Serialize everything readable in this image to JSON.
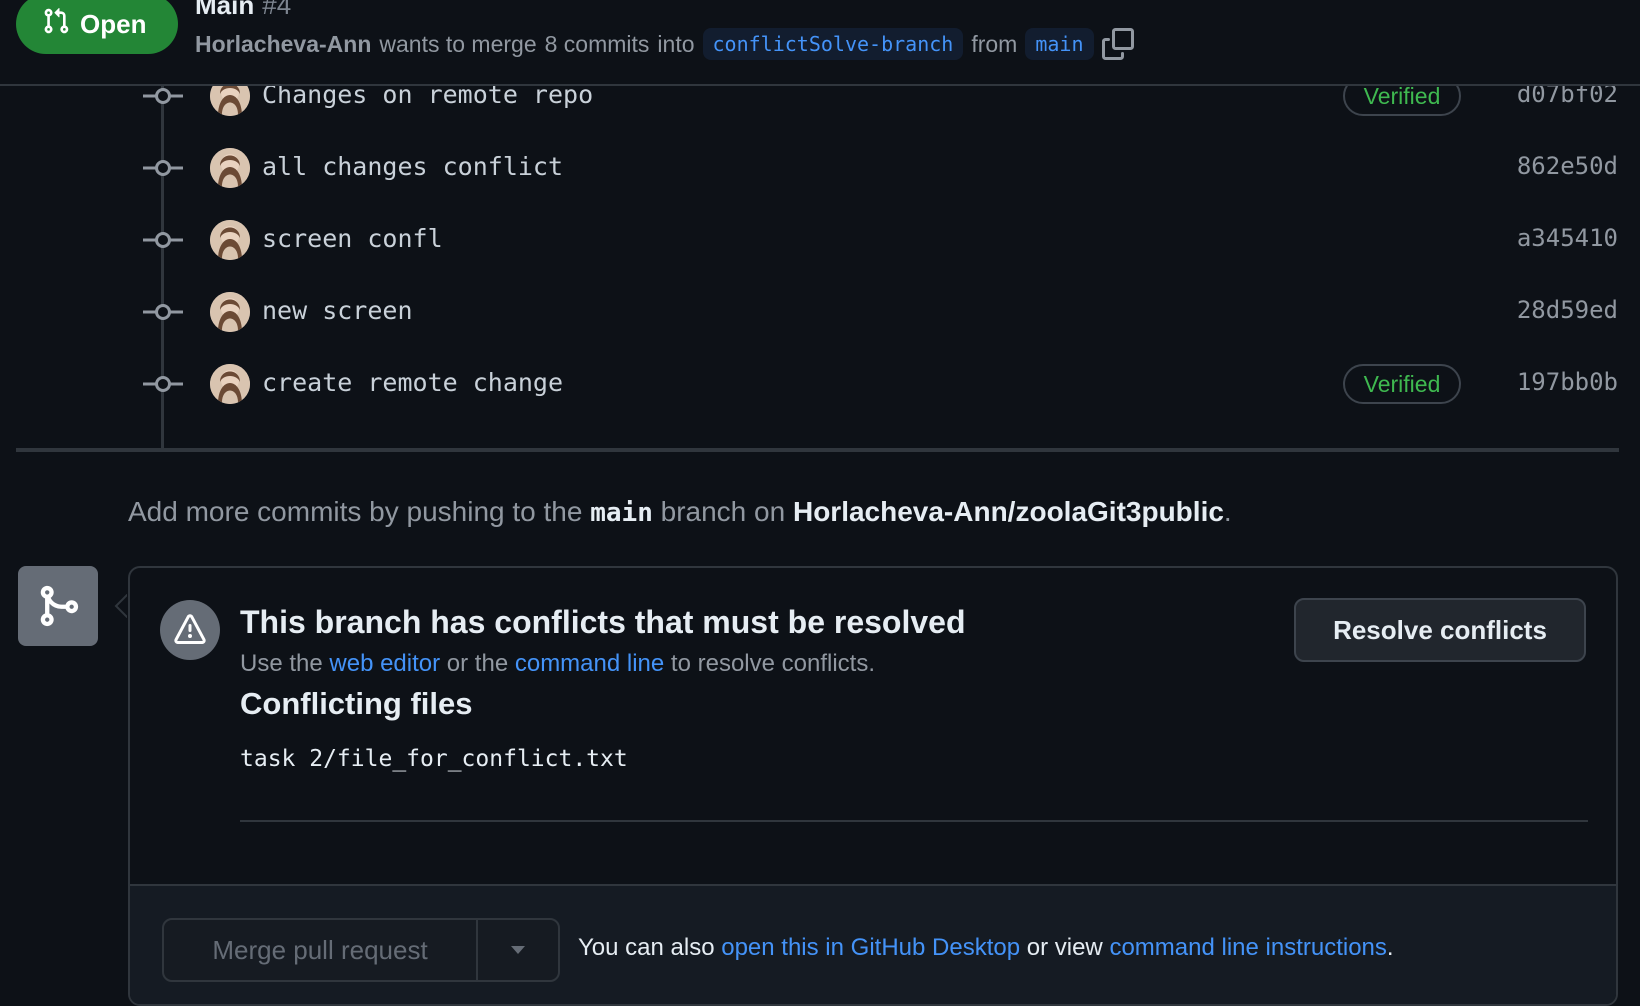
{
  "header": {
    "state": "Open",
    "title": "Main",
    "number": "#4",
    "author": "Horlacheva-Ann",
    "merge_text_1": "wants to merge",
    "commit_count_text": "8 commits",
    "merge_text_2": "into",
    "base_branch": "conflictSolve-branch",
    "from_text": "from",
    "head_branch": "main"
  },
  "commits": [
    {
      "message": "Changes on remote repo",
      "verified": true,
      "verified_label": "Verified",
      "sha": "d07bf02"
    },
    {
      "message": "all changes conflict",
      "verified": false,
      "verified_label": "",
      "sha": "862e50d"
    },
    {
      "message": "screen confl",
      "verified": false,
      "verified_label": "",
      "sha": "a345410"
    },
    {
      "message": "new screen",
      "verified": false,
      "verified_label": "",
      "sha": "28d59ed"
    },
    {
      "message": "create remote change",
      "verified": true,
      "verified_label": "Verified",
      "sha": "197bb0b"
    }
  ],
  "push_hint": {
    "prefix": "Add more commits by pushing to the",
    "branch": "main",
    "middle": "branch on",
    "repo": "Horlacheva-Ann/zoolaGit3public",
    "suffix": "."
  },
  "merge_box": {
    "title": "This branch has conflicts that must be resolved",
    "sub_prefix": "Use the",
    "web_editor_link": "web editor",
    "sub_middle": "or the",
    "command_line_link": "command line",
    "sub_suffix": "to resolve conflicts.",
    "resolve_button": "Resolve conflicts",
    "files_heading": "Conflicting files",
    "files": [
      "task 2/file_for_conflict.txt"
    ],
    "merge_button": "Merge pull request",
    "footer_prefix": "You can also",
    "desktop_link": "open this in GitHub Desktop",
    "footer_middle": "or view",
    "instructions_link": "command line instructions",
    "footer_suffix": "."
  },
  "colors": {
    "background": "#0d1117",
    "open_green": "#238636",
    "verified_green": "#3fb950",
    "link_blue": "#4493f8",
    "muted": "#9198a1"
  },
  "icons": [
    "git-pull-request-icon",
    "copy-icon",
    "commit-node-icon",
    "avatar",
    "git-merge-icon",
    "alert-icon",
    "triangle-down-icon"
  ]
}
